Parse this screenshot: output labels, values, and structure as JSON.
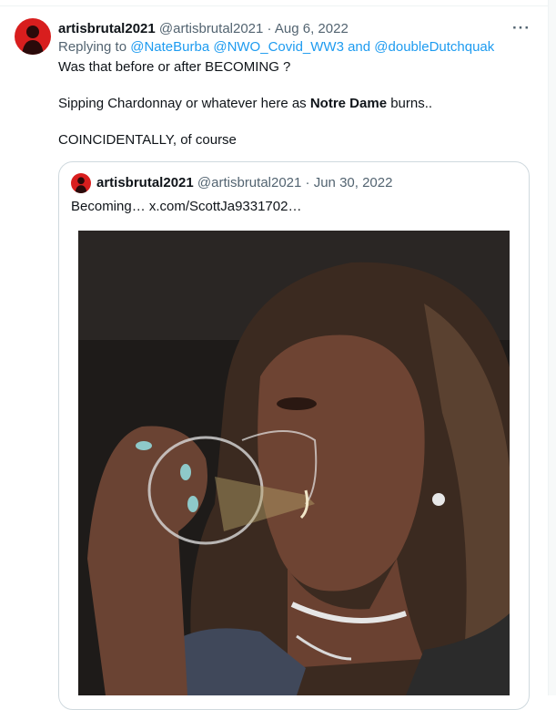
{
  "tweet": {
    "display_name": "artisbrutal2021",
    "handle": "@artisbrutal2021",
    "separator": "·",
    "date": "Aug 6, 2022",
    "more_label": "···",
    "replying_prefix": "Replying to",
    "reply_targets": [
      "@NateBurba",
      "@NWO_Covid_WW3",
      "@doubleDutchquak"
    ],
    "reply_and": "and",
    "line1": "Was that before or after BECOMING ?",
    "line2_before": "Sipping Chardonnay or whatever here as ",
    "line2_bold": "Notre Dame",
    "line2_after": " burns..",
    "line3": "COINCIDENTALLY, of course"
  },
  "quote": {
    "display_name": "artisbrutal2021",
    "handle": "@artisbrutal2021",
    "separator": "·",
    "date": "Jun 30, 2022",
    "text": "Becoming…  x.com/ScottJa9331702…",
    "image_description": "photo"
  },
  "colors": {
    "text": "#0f1419",
    "muted": "#536471",
    "link": "#1d9bf0",
    "border": "#cfd9de"
  }
}
